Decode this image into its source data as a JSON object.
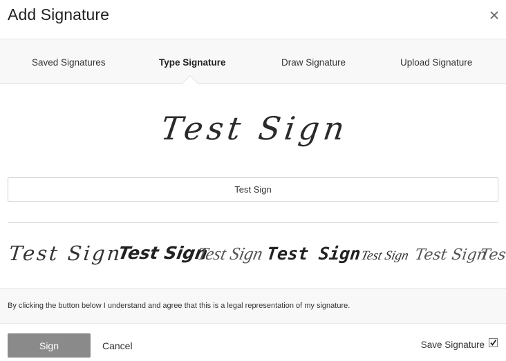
{
  "dialog": {
    "title": "Add Signature",
    "close_icon": "close-icon"
  },
  "tabs": [
    {
      "label": "Saved Signatures",
      "active": false
    },
    {
      "label": "Type Signature",
      "active": true
    },
    {
      "label": "Draw Signature",
      "active": false
    },
    {
      "label": "Upload Signature",
      "active": false
    }
  ],
  "signature": {
    "preview_text": "Test Sign",
    "input_value": "Test Sign",
    "style_options": [
      "Test Sign",
      "Test Sign",
      "Test Sign",
      "Test Sign",
      "Test Sign",
      "Test Sign",
      "Tes"
    ]
  },
  "disclaimer": "By clicking the button below I understand and agree that this is a legal representation of my signature.",
  "footer": {
    "sign_label": "Sign",
    "cancel_label": "Cancel",
    "save_label": "Save Signature",
    "save_checked": true
  },
  "colors": {
    "sign_button": "#8a8a8a",
    "tab_band": "#f8f8f8",
    "signature_ink": "#2a2a2a"
  }
}
